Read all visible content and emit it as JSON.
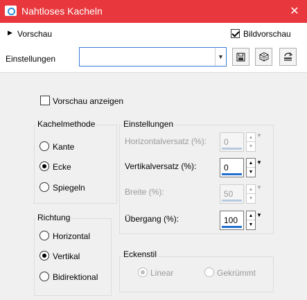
{
  "window": {
    "title": "Nahtloses Kacheln",
    "close_symbol": "✕"
  },
  "preview": {
    "label": "Vorschau",
    "bildvorschau_label": "Bildvorschau",
    "bildvorschau_checked": true
  },
  "settings_row": {
    "label": "Einstellungen",
    "preset_value": "",
    "tools": [
      "save-preset-icon",
      "randomize-icon",
      "reset-icon"
    ]
  },
  "vorschau_anzeigen": {
    "label": "Vorschau anzeigen",
    "checked": false
  },
  "kachelmethode": {
    "title": "Kachelmethode",
    "options": [
      "Kante",
      "Ecke",
      "Spiegeln"
    ],
    "selected": "Ecke"
  },
  "richtung": {
    "title": "Richtung",
    "options": [
      "Horizontal",
      "Vertikal",
      "Bidirektional"
    ],
    "selected": "Vertikal"
  },
  "einstellungen": {
    "title": "Einstellungen",
    "horizontalversatz": {
      "label": "Horizontalversatz (%):",
      "value": "0",
      "enabled": false
    },
    "vertikalversatz": {
      "label": "Vertikalversatz (%):",
      "value": "0",
      "enabled": true
    },
    "breite": {
      "label": "Breite (%):",
      "value": "50",
      "enabled": false
    },
    "uebergang": {
      "label": "Übergang (%):",
      "value": "100",
      "enabled": true
    }
  },
  "eckenstil": {
    "title": "Eckenstil",
    "options": [
      "Linear",
      "Gekrümmt"
    ],
    "selected": "Linear",
    "enabled": false
  },
  "colors": {
    "titlebar": "#e8383d",
    "accent": "#1f6fcf"
  }
}
